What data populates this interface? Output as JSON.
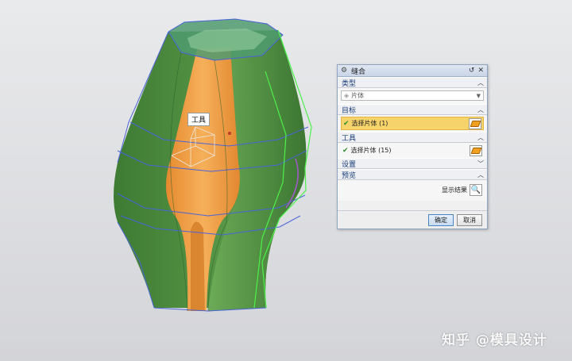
{
  "dialog": {
    "title": "缝合",
    "sections": {
      "type": {
        "label": "类型",
        "select_value": "片体"
      },
      "target": {
        "label": "目标",
        "row_text": "选择片体 (1)"
      },
      "tool": {
        "label": "工具",
        "row_text": "选择片体 (15)"
      },
      "settings": {
        "label": "设置"
      },
      "preview": {
        "label": "预览",
        "show_result": "显示结果"
      }
    },
    "buttons": {
      "ok": "确定",
      "cancel": "取消"
    }
  },
  "viewport": {
    "tooltip_label": "工具",
    "colors": {
      "sheet_green": "#5f9e4a",
      "sheet_green_dark": "#3f7a34",
      "tool_orange": "#f0a049",
      "edge_blue": "#4a63d8",
      "edge_green": "#4cf04a"
    }
  },
  "watermark": "知乎 @模具设计"
}
